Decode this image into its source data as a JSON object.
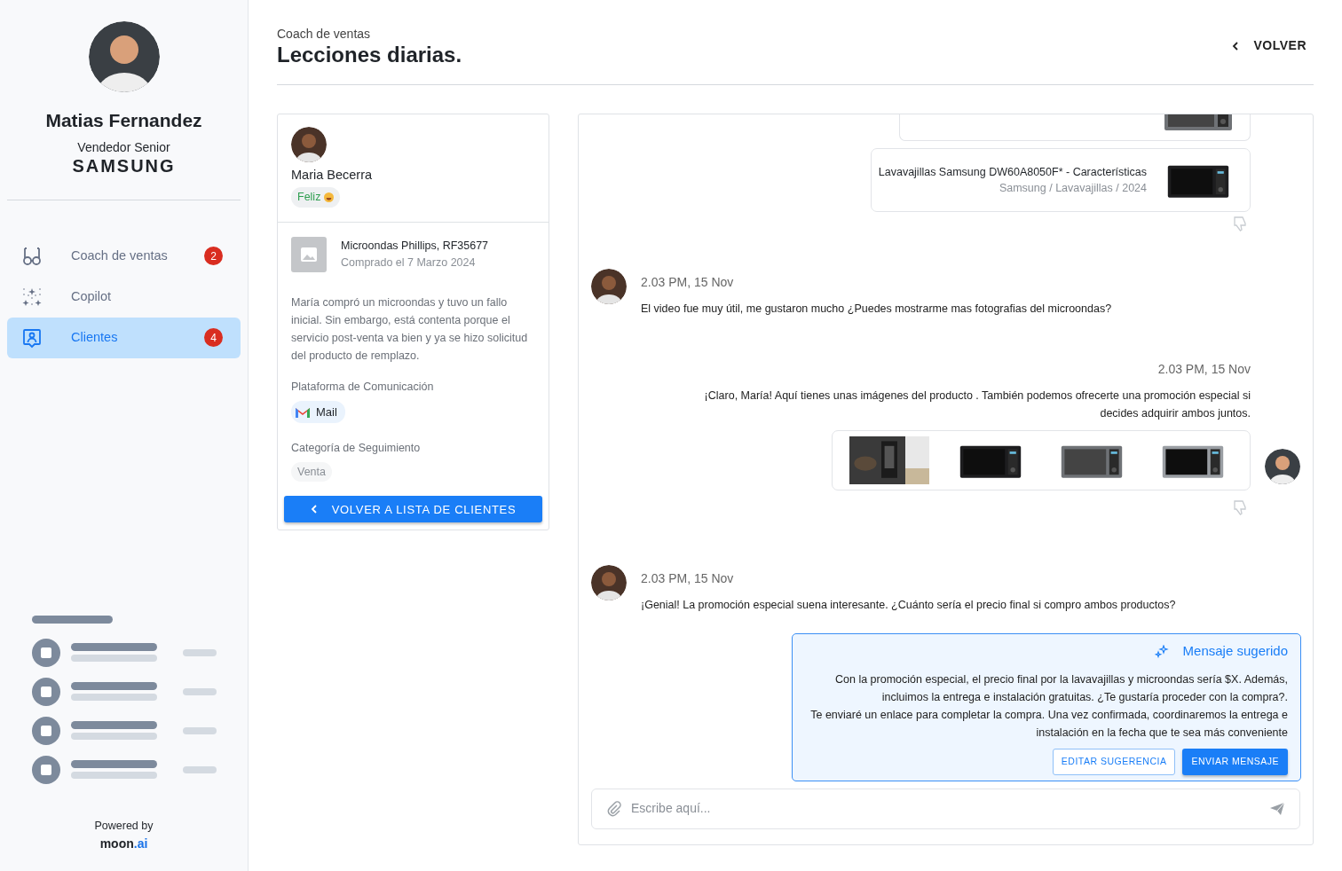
{
  "user": {
    "name": "Matias Fernandez",
    "role": "Vendedor Senior",
    "company": "SAMSUNG"
  },
  "nav": [
    {
      "label": "Coach de ventas",
      "kind": "glasses",
      "badge": "2",
      "selected": false
    },
    {
      "label": "Copilot",
      "kind": "sparkles",
      "selected": false
    },
    {
      "label": "Clientes",
      "kind": "contact",
      "badge": "4",
      "selected": true
    }
  ],
  "footer": {
    "powered_by": "Powered by",
    "brand": [
      "moon",
      ".ai"
    ]
  },
  "header": {
    "subtitle": "Coach de ventas",
    "title": "Lecciones diarias.",
    "back": "VOLVER"
  },
  "customer": {
    "name": "Maria Becerra",
    "mood": "Feliz",
    "product": {
      "name": "Microondas Phillips, RF35677",
      "purchased": "Comprado el 7 Marzo 2024"
    },
    "summary": "María compró un microondas y tuvo un fallo inicial. Sin embargo, está contenta porque el servicio post-venta va bien y ya se hizo solicitud del producto de remplazo.",
    "platform_label": "Plataforma de Comunicación",
    "platform": "Mail",
    "category_label": "Categoría de Seguimiento",
    "category": "Venta",
    "back_button": "VOLVER A LISTA DE CLIENTES"
  },
  "chat": [
    {
      "kind": "links",
      "items": [
        {
          "title": "Lavavajillas Samsung DW60A8050F* - Características",
          "subtitle": "Samsung / Lavavajillas / 2024"
        }
      ]
    },
    {
      "kind": "incoming",
      "time": "2.03 PM, 15 Nov",
      "text": "El video fue muy útil, me gustaron mucho ¿Puedes mostrarme mas fotografias del microondas?"
    },
    {
      "kind": "outgoing",
      "time": "2.03 PM, 15 Nov",
      "text": "¡Claro, María! Aquí tienes unas imágenes del producto . También podemos ofrecerte una promoción especial si decides adquirir ambos juntos."
    },
    {
      "kind": "incoming",
      "time": "2.03 PM, 15 Nov",
      "text": "¡Genial! La promoción especial suena interesante. ¿Cuánto sería el precio final si compro ambos productos?"
    }
  ],
  "suggestion": {
    "title": "Mensaje sugerido",
    "text": "Con la promoción especial, el precio final por la lavavajillas y microondas sería $X. Además, incluimos la entrega e instalación gratuitas. ¿Te gustaría proceder con la compra?.\nTe enviaré un enlace para completar la compra. Una vez confirmada, coordinaremos la entrega e instalación en la fecha que te sea más conveniente",
    "edit": "EDITAR SUGERENCIA",
    "send": "ENVIAR MENSAJE"
  },
  "composer": {
    "placeholder": "Escribe aquí..."
  }
}
